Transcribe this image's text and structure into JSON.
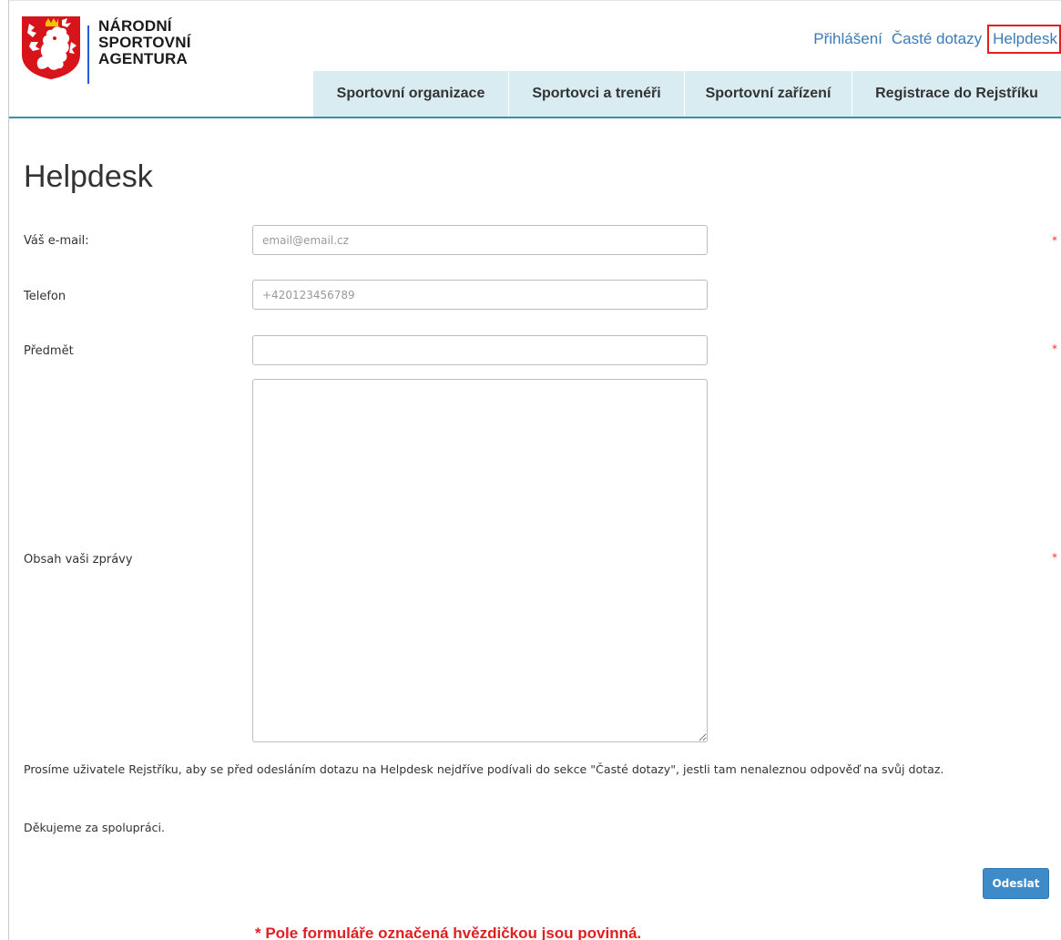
{
  "header": {
    "org_name": [
      "NÁRODNÍ",
      "SPORTOVNÍ",
      "AGENTURA"
    ],
    "top_links": [
      "Přihlášení",
      "Časté dotazy",
      "Helpdesk"
    ],
    "active_link": "Helpdesk",
    "nav": [
      "Sportovní organizace",
      "Sportovci a trenéři",
      "Sportovní zařízení",
      "Registrace do Rejstříku"
    ]
  },
  "page": {
    "title": "Helpdesk"
  },
  "form": {
    "email_label": "Váš e-mail:",
    "email_placeholder": "email@email.cz",
    "phone_label": "Telefon",
    "phone_placeholder": "+420123456789",
    "subject_label": "Předmět",
    "subject_value": "",
    "message_label": "Obsah vaši zprávy",
    "required_mark": "*",
    "submit_label": "Odeslat"
  },
  "texts": {
    "notice": "Prosíme uživatele Rejstříku, aby se před odesláním dotazu na Helpdesk nejdříve podívali do sekce \"Časté dotazy\", jestli tam nenaleznou odpověď na svůj dotaz.",
    "thanks": "Děkujeme za spolupráci.",
    "required_note": "* Pole formuláře označená hvězdičkou jsou povinná."
  },
  "colors": {
    "nav_bg": "#d8ecf1",
    "link": "#3a7ab8",
    "accent_rule": "#3b8fa7",
    "button": "#3d8bc9",
    "required": "#e02020",
    "logo_red": "#d7141a"
  }
}
